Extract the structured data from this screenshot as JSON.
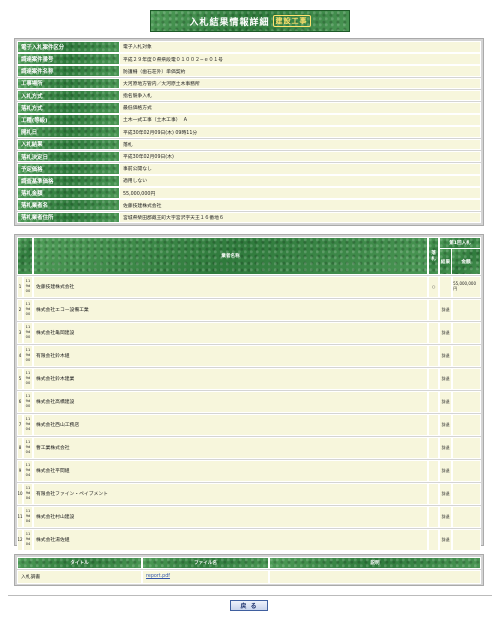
{
  "page": {
    "title": "入札結果情報詳細",
    "title_suffix": "建設工事"
  },
  "info": [
    {
      "label": "電子入札案件区分",
      "value": "電子入札対象"
    },
    {
      "label": "調達案件番号",
      "value": "平成２９年度０県県段電０１００２−ｅ０１号"
    },
    {
      "label": "調達案件名称",
      "value": "防護柵（歯石荘外）単価契約"
    },
    {
      "label": "工事場所",
      "value": "大河原地方管内／大河原土木事務所"
    },
    {
      "label": "入札方式",
      "value": "指名競争入札"
    },
    {
      "label": "落札方式",
      "value": "最低価格方式"
    },
    {
      "label": "工種(等級)",
      "value": "土木一式工事（土木工事）　Ａ"
    },
    {
      "label": "開札日",
      "value": "平成30年02月09日(木) 09時11分"
    },
    {
      "label": "入札結果",
      "value": "落札"
    },
    {
      "label": "落札決定日",
      "value": "平成30年02月09日(木)"
    },
    {
      "label": "予定価格",
      "value": "事前公開なし"
    },
    {
      "label": "調査基準価格",
      "value": "適用しない"
    },
    {
      "label": "落札金額",
      "value": "55,000,000円"
    },
    {
      "label": "落札業者名",
      "value": "佐藤技建株式会社"
    },
    {
      "label": "落札業者住所",
      "value": "宮城県柴田郡蔵王町大字宮沢字天王１６番地６"
    }
  ],
  "bids": {
    "headers": {
      "company": "業者名称",
      "mark": "落札",
      "round_group": "第1回入札",
      "result": "結果",
      "amount": "金額"
    },
    "rows": [
      {
        "idx": "1",
        "num": [
          "11",
          "9d",
          "00"
        ],
        "name": "佐藤技建株式会社",
        "mark": "○",
        "result": "",
        "amount": "55,000,000円"
      },
      {
        "idx": "2",
        "num": [
          "11",
          "9d",
          "00"
        ],
        "name": "株式会社エコー設備工業",
        "mark": "",
        "result": "辞退",
        "amount": ""
      },
      {
        "idx": "3",
        "num": [
          "11",
          "9d",
          "00"
        ],
        "name": "株式会社亀岡建設",
        "mark": "",
        "result": "辞退",
        "amount": ""
      },
      {
        "idx": "4",
        "num": [
          "11",
          "9d",
          "00"
        ],
        "name": "有限会社鈴木組",
        "mark": "",
        "result": "辞退",
        "amount": ""
      },
      {
        "idx": "5",
        "num": [
          "11",
          "9d",
          "00"
        ],
        "name": "株式会社鈴木建業",
        "mark": "",
        "result": "辞退",
        "amount": ""
      },
      {
        "idx": "6",
        "num": [
          "11",
          "9d",
          "00"
        ],
        "name": "株式会社高橋建設",
        "mark": "",
        "result": "辞退",
        "amount": ""
      },
      {
        "idx": "7",
        "num": [
          "11",
          "9d",
          "04"
        ],
        "name": "株式会社西山工務店",
        "mark": "",
        "result": "辞退",
        "amount": ""
      },
      {
        "idx": "8",
        "num": [
          "11",
          "9d",
          "04"
        ],
        "name": "曹工業株式会社",
        "mark": "",
        "result": "辞退",
        "amount": ""
      },
      {
        "idx": "9",
        "num": [
          "11",
          "9d",
          "04"
        ],
        "name": "株式会社平間組",
        "mark": "",
        "result": "辞退",
        "amount": ""
      },
      {
        "idx": "10",
        "num": [
          "11",
          "9d",
          "04"
        ],
        "name": "有限会社ファイン・ペイブメント",
        "mark": "",
        "result": "辞退",
        "amount": ""
      },
      {
        "idx": "11",
        "num": [
          "11",
          "9d",
          "04"
        ],
        "name": "株式会社村山建設",
        "mark": "",
        "result": "辞退",
        "amount": ""
      },
      {
        "idx": "12",
        "num": [
          "11",
          "9d",
          "04"
        ],
        "name": "株式会社湯佐組",
        "mark": "",
        "result": "辞退",
        "amount": ""
      }
    ]
  },
  "documents": {
    "headers": {
      "title": "タイトル",
      "file": "ファイル名",
      "description": "説明"
    },
    "rows": [
      {
        "title": "入札調書",
        "file": "report.pdf",
        "description": ""
      }
    ]
  },
  "back_button": "戻 る"
}
